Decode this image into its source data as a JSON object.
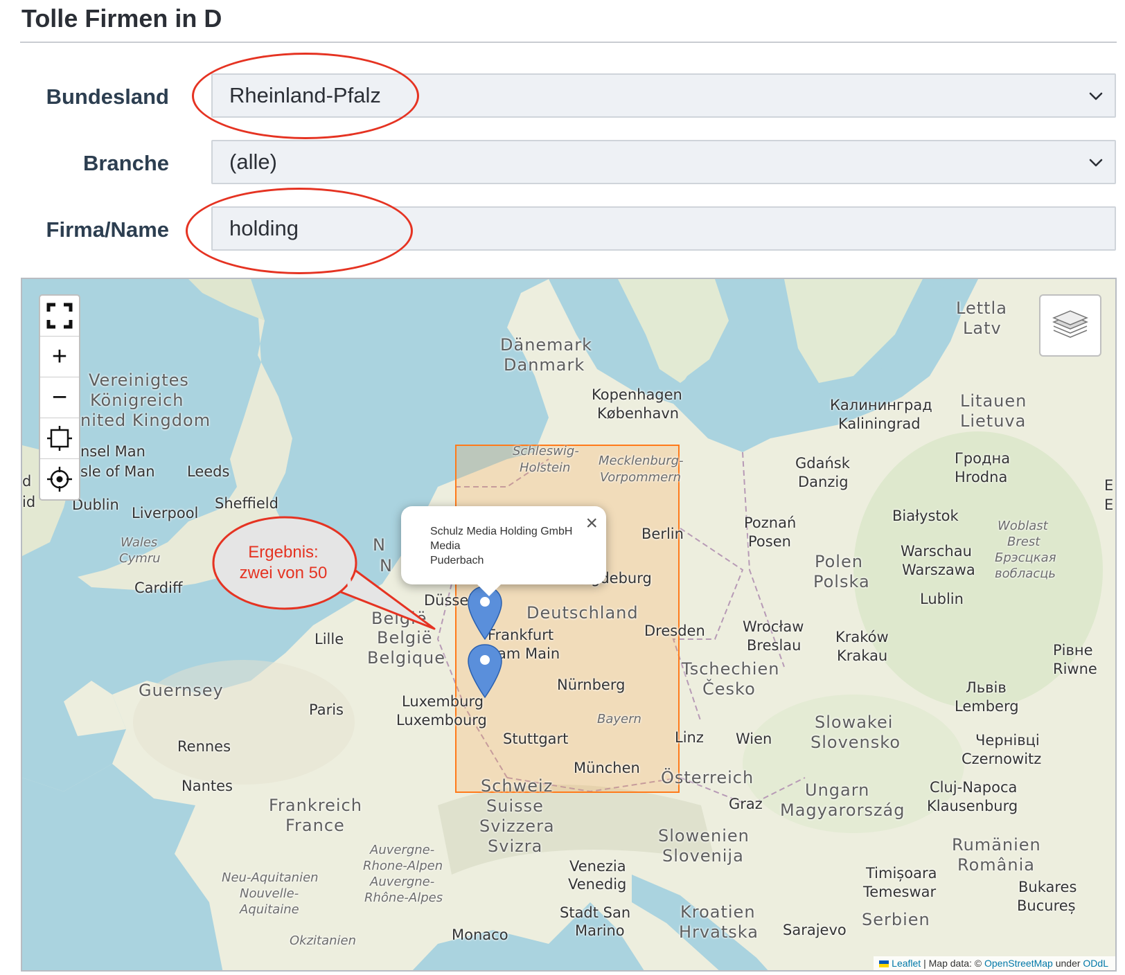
{
  "page": {
    "title": "Tolle Firmen in D"
  },
  "form": {
    "bundesland_label": "Bundesland",
    "bundesland_value": "Rheinland-Pfalz",
    "branche_label": "Branche",
    "branche_value": "(alle)",
    "firma_label": "Firma/Name",
    "firma_value": "holding"
  },
  "map": {
    "popup": {
      "name": "Schulz Media Holding GmbH",
      "branche": "Media",
      "ort": "Puderbach",
      "close": "×"
    },
    "callout": {
      "line1": "Ergebnis:",
      "line2": "zwei von 50"
    },
    "attribution": {
      "leaflet": "Leaflet",
      "separator": " | Map data: © ",
      "osm": "OpenStreetMap",
      "under": " under ",
      "license": "ODdL"
    },
    "controls": {
      "fullscreen_icon": "fullscreen-icon",
      "zoom_in": "+",
      "zoom_out": "−",
      "box_zoom_icon": "box-zoom-icon",
      "locate_icon": "locate-icon",
      "layers_icon": "layers-icon"
    },
    "labels": {
      "daenemark": "Dänemark",
      "danmark": "Danmark",
      "kopenhagen": "Kopenhagen",
      "kobenhavn": "København",
      "ver_koenig1": "Vereinigtes",
      "ver_koenig2": "Königreich",
      "uk": "nited Kingdom",
      "insel_man": "nsel Man",
      "isle_of_man": "sle of Man",
      "leeds": "Leeds",
      "dublin": "Dublin",
      "liverpool": "Liverpool",
      "sheffield": "Sheffield",
      "wales": "Wales",
      "cymru": "Cymru",
      "cardiff": "Cardiff",
      "schleswig": "Schleswig-",
      "holstein": "Holstein",
      "mecklenburg": "Mecklenburg-",
      "vorpommern": "Vorpommern",
      "berlin": "Berlin",
      "magdeburg": "Magdeburg",
      "duessel": "Düssel",
      "deutschland": "Deutschland",
      "frankfurt": "Frankfurt",
      "am_main": "am Main",
      "dresden": "Dresden",
      "nuernberg": "Nürnberg",
      "bayern": "Bayern",
      "stuttgart": "Stuttgart",
      "muenchen": "München",
      "belgie1": "België",
      "belgie2": "België",
      "belgique": "Belgique",
      "lille": "Lille",
      "luxemburg": "Luxemburg",
      "luxembourg": "Luxembourg",
      "guernsey": "Guernsey",
      "paris": "Paris",
      "rennes": "Rennes",
      "nantes": "Nantes",
      "frankreich": "Frankreich",
      "france": "France",
      "schweiz": "Schweiz",
      "suisse": "Suisse",
      "svizzera": "Svizzera",
      "svizra": "Svizra",
      "auvergne1": "Auvergne-",
      "auvergne2": "Rhone-Alpen",
      "auvergne3": "Auvergne-",
      "auvergne4": "Rhône-Alpes",
      "neu_aquitanien": "Neu-Aquitanien",
      "nouvelle": "Nouvelle-",
      "aquitaine": "Aquitaine",
      "okzitanien": "Okzitanien",
      "monaco": "Monaco",
      "venezia": "Venezia",
      "venedig": "Venedig",
      "stadt_san": "Stadt San",
      "marino": "Marino",
      "kaliningrad_ru": "Калининград",
      "kaliningrad": "Kaliningrad",
      "litauen": "Litauen",
      "lietuva": "Lietuva",
      "lettl": "Lettla",
      "latv": "Latv",
      "gdansk": "Gdańsk",
      "danzig": "Danzig",
      "grodna": "Гродна",
      "hrodna": "Hrodna",
      "bialystok": "Białystok",
      "poznan": "Poznań",
      "posen": "Posen",
      "polen": "Polen",
      "polska": "Polska",
      "warschau": "Warschau",
      "warszawa": "Warszawa",
      "woblast": "Woblast",
      "brest": "Brest",
      "brest_by": "Брэсцкая",
      "voblasc": "вобласць",
      "lublin": "Lublin",
      "wroclaw": "Wrocław",
      "breslau": "Breslau",
      "krakow": "Kraków",
      "krakau": "Krakau",
      "tschechien": "Tschechien",
      "cesko": "Česko",
      "rivne_ua": "Рівне",
      "rivne": "Riwne",
      "lviv_ua": "Львів",
      "lemberg": "Lemberg",
      "slowakei": "Slowakei",
      "slovensko": "Slovensko",
      "linz": "Linz",
      "wien": "Wien",
      "oesterreich": "Österreich",
      "graz": "Graz",
      "chernivtsi_ua": "Чернівці",
      "czernowitz": "Czernowitz",
      "ungarn": "Ungarn",
      "magyarorszag": "Magyarország",
      "cluj": "Cluj-Napoca",
      "klausenburg": "Klausenburg",
      "slowenien": "Slowenien",
      "slovenija": "Slovenija",
      "rumaenien": "Rumänien",
      "romania": "România",
      "timisoara": "Timișoara",
      "temeswar": "Temeswar",
      "kroatien": "Kroatien",
      "hrvatska": "Hrvatska",
      "serbien": "Serbien",
      "sarajevo": "Sarajevo",
      "bukarest": "Bukares",
      "bucuresti": "Bucureș",
      "edge_e1": "E",
      "edge_e2": "E",
      "edge_d": "d",
      "edge_id": "id",
      "n1": "N",
      "n2": "N"
    }
  },
  "colors": {
    "annotation": "#e53322",
    "bbox": "#ff7a1a",
    "marker": "#2a81cb",
    "water": "#aad3df",
    "land": "#f2efe9"
  }
}
